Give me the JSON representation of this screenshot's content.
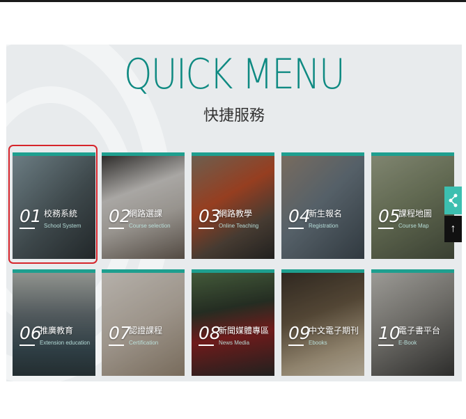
{
  "header": {
    "title": "QUICK MENU",
    "subtitle": "快捷服務"
  },
  "tiles": [
    {
      "num": "01",
      "label": "校務系統",
      "sub": "School System",
      "bg": "#5c6c70"
    },
    {
      "num": "02",
      "label": "網路選課",
      "sub": "Course selection",
      "bg": "#6f6a66"
    },
    {
      "num": "03",
      "label": "網路教學",
      "sub": "Online Teaching",
      "bg": "#6a5a4c"
    },
    {
      "num": "04",
      "label": "新生報名",
      "sub": "Registration",
      "bg": "#5a6a78"
    },
    {
      "num": "05",
      "label": "課程地圖",
      "sub": "Course Map",
      "bg": "#6f7a66"
    },
    {
      "num": "06",
      "label": "推廣教育",
      "sub": "Extension education",
      "bg": "#4e6a72"
    },
    {
      "num": "07",
      "label": "認證課程",
      "sub": "Certification",
      "bg": "#8a8680"
    },
    {
      "num": "08",
      "label": "新聞媒體專區",
      "sub": "News Media",
      "bg": "#4a4f44"
    },
    {
      "num": "09",
      "label": "中文電子期刊",
      "sub": "Ebooks",
      "bg": "#6c5d48"
    },
    {
      "num": "10",
      "label": "電子書平台",
      "sub": "E-Book",
      "bg": "#7a7a76"
    }
  ],
  "side": {
    "share_icon": "share-icon",
    "top_icon": "arrow-up-icon",
    "top_glyph": "↑"
  },
  "colors": {
    "accent": "#1e9f8f",
    "title": "#0f8a82",
    "highlight": "#d6242b"
  }
}
